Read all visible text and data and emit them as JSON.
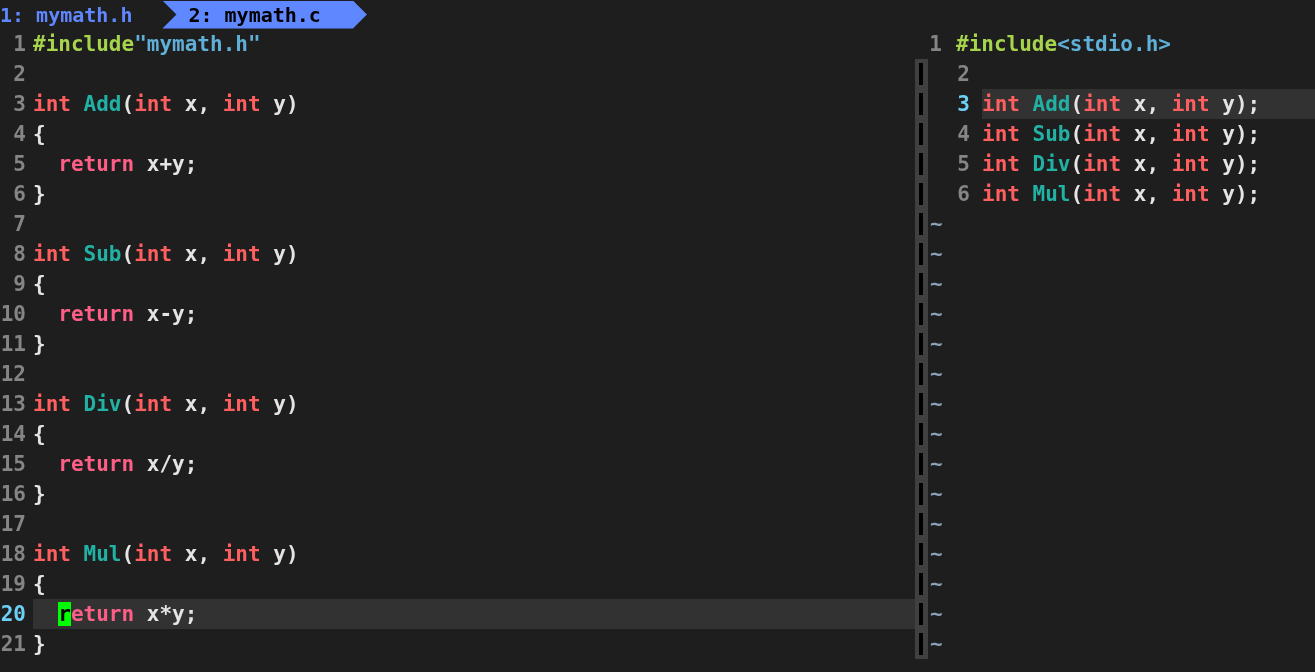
{
  "tabs": [
    {
      "label": "1: mymath.h",
      "selected": false
    },
    {
      "label": "2: mymath.c",
      "selected": true
    }
  ],
  "left_pane": {
    "lines": [
      {
        "number": "1",
        "current": false,
        "tokens": [
          {
            "kind": "preproc",
            "text": "#include"
          },
          {
            "kind": "string",
            "text": "\"mymath.h\""
          }
        ]
      },
      {
        "number": "2",
        "current": false
      },
      {
        "number": "3",
        "current": false,
        "tokens": [
          {
            "kind": "type",
            "text": "int "
          },
          {
            "kind": "func",
            "text": "Add"
          },
          {
            "kind": "plain",
            "text": "("
          },
          {
            "kind": "type",
            "text": "int"
          },
          {
            "kind": "plain",
            "text": " x, "
          },
          {
            "kind": "type",
            "text": "int"
          },
          {
            "kind": "plain",
            "text": " y)"
          }
        ]
      },
      {
        "number": "4",
        "current": false,
        "tokens": [
          {
            "kind": "plain",
            "text": "{"
          }
        ]
      },
      {
        "number": "5",
        "current": false,
        "indented": true,
        "tokens": [
          {
            "kind": "keyword",
            "text": "return"
          },
          {
            "kind": "plain",
            "text": " x+y;"
          }
        ]
      },
      {
        "number": "6",
        "current": false,
        "tokens": [
          {
            "kind": "plain",
            "text": "}"
          }
        ]
      },
      {
        "number": "7",
        "current": false
      },
      {
        "number": "8",
        "current": false,
        "tokens": [
          {
            "kind": "type",
            "text": "int "
          },
          {
            "kind": "func",
            "text": "Sub"
          },
          {
            "kind": "plain",
            "text": "("
          },
          {
            "kind": "type",
            "text": "int"
          },
          {
            "kind": "plain",
            "text": " x, "
          },
          {
            "kind": "type",
            "text": "int"
          },
          {
            "kind": "plain",
            "text": " y)"
          }
        ]
      },
      {
        "number": "9",
        "current": false,
        "tokens": [
          {
            "kind": "plain",
            "text": "{"
          }
        ]
      },
      {
        "number": "10",
        "current": false,
        "indented": true,
        "tokens": [
          {
            "kind": "keyword",
            "text": "return"
          },
          {
            "kind": "plain",
            "text": " x-y;"
          }
        ]
      },
      {
        "number": "11",
        "current": false,
        "tokens": [
          {
            "kind": "plain",
            "text": "}"
          }
        ]
      },
      {
        "number": "12",
        "current": false
      },
      {
        "number": "13",
        "current": false,
        "tokens": [
          {
            "kind": "type",
            "text": "int "
          },
          {
            "kind": "func",
            "text": "Div"
          },
          {
            "kind": "plain",
            "text": "("
          },
          {
            "kind": "type",
            "text": "int"
          },
          {
            "kind": "plain",
            "text": " x, "
          },
          {
            "kind": "type",
            "text": "int"
          },
          {
            "kind": "plain",
            "text": " y)"
          }
        ]
      },
      {
        "number": "14",
        "current": false,
        "tokens": [
          {
            "kind": "plain",
            "text": "{"
          }
        ]
      },
      {
        "number": "15",
        "current": false,
        "indented": true,
        "tokens": [
          {
            "kind": "keyword",
            "text": "return"
          },
          {
            "kind": "plain",
            "text": " x/y;"
          }
        ]
      },
      {
        "number": "16",
        "current": false,
        "tokens": [
          {
            "kind": "plain",
            "text": "}"
          }
        ]
      },
      {
        "number": "17",
        "current": false
      },
      {
        "number": "18",
        "current": false,
        "tokens": [
          {
            "kind": "type",
            "text": "int "
          },
          {
            "kind": "func",
            "text": "Mul"
          },
          {
            "kind": "plain",
            "text": "("
          },
          {
            "kind": "type",
            "text": "int"
          },
          {
            "kind": "plain",
            "text": " x, "
          },
          {
            "kind": "type",
            "text": "int"
          },
          {
            "kind": "plain",
            "text": " y)"
          }
        ]
      },
      {
        "number": "19",
        "current": false,
        "tokens": [
          {
            "kind": "plain",
            "text": "{"
          }
        ]
      },
      {
        "number": "20",
        "current": true,
        "indented": true,
        "tokens": [
          {
            "kind": "cursor",
            "text": "r"
          },
          {
            "kind": "keyword",
            "text": "eturn"
          },
          {
            "kind": "plain",
            "text": " x*y;"
          }
        ]
      },
      {
        "number": "21",
        "current": false,
        "tokens": [
          {
            "kind": "plain",
            "text": "}"
          }
        ]
      }
    ]
  },
  "right_pane": {
    "lines": [
      {
        "number": "1",
        "current": false,
        "tokens": [
          {
            "kind": "preproc",
            "text": "#include"
          },
          {
            "kind": "string",
            "text": "<stdio.h>"
          }
        ]
      },
      {
        "number": "2",
        "current": false
      },
      {
        "number": "3",
        "current": true,
        "tokens": [
          {
            "kind": "type",
            "text": "int "
          },
          {
            "kind": "func",
            "text": "Add"
          },
          {
            "kind": "plain",
            "text": "("
          },
          {
            "kind": "type",
            "text": "int"
          },
          {
            "kind": "plain",
            "text": " x, "
          },
          {
            "kind": "type",
            "text": "int"
          },
          {
            "kind": "plain",
            "text": " y);"
          }
        ]
      },
      {
        "number": "4",
        "current": false,
        "tokens": [
          {
            "kind": "type",
            "text": "int "
          },
          {
            "kind": "func",
            "text": "Sub"
          },
          {
            "kind": "plain",
            "text": "("
          },
          {
            "kind": "type",
            "text": "int"
          },
          {
            "kind": "plain",
            "text": " x, "
          },
          {
            "kind": "type",
            "text": "int"
          },
          {
            "kind": "plain",
            "text": " y);"
          }
        ]
      },
      {
        "number": "5",
        "current": false,
        "tokens": [
          {
            "kind": "type",
            "text": "int "
          },
          {
            "kind": "func",
            "text": "Div"
          },
          {
            "kind": "plain",
            "text": "("
          },
          {
            "kind": "type",
            "text": "int"
          },
          {
            "kind": "plain",
            "text": " x, "
          },
          {
            "kind": "type",
            "text": "int"
          },
          {
            "kind": "plain",
            "text": " y);"
          }
        ]
      },
      {
        "number": "6",
        "current": false,
        "tokens": [
          {
            "kind": "type",
            "text": "int "
          },
          {
            "kind": "func",
            "text": "Mul"
          },
          {
            "kind": "plain",
            "text": "("
          },
          {
            "kind": "type",
            "text": "int"
          },
          {
            "kind": "plain",
            "text": " x, "
          },
          {
            "kind": "type",
            "text": "int"
          },
          {
            "kind": "plain",
            "text": " y);"
          }
        ]
      }
    ],
    "filler": [
      "~",
      "~",
      "~",
      "~",
      "~",
      "~",
      "~",
      "~",
      "~",
      "~",
      "~",
      "~",
      "~",
      "~",
      "~"
    ]
  }
}
